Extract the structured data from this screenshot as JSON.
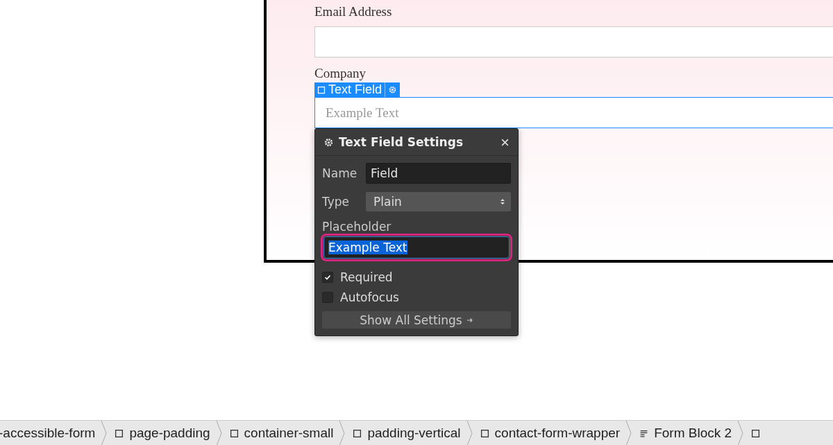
{
  "canvas": {
    "fields": [
      {
        "label": "Email Address",
        "selected": false
      },
      {
        "label": "Company",
        "placeholder": "Example Text",
        "selected": true,
        "tag": "Text Field"
      }
    ]
  },
  "settings_popup": {
    "title": "Text Field Settings",
    "name_label": "Name",
    "name_value": "Field",
    "type_label": "Type",
    "type_value": "Plain",
    "placeholder_label": "Placeholder",
    "placeholder_value": "Example Text",
    "options": [
      {
        "label": "Required",
        "checked": true
      },
      {
        "label": "Autofocus",
        "checked": false
      }
    ],
    "button": "Show All Settings"
  },
  "breadcrumbs": [
    {
      "label": "-accessible-form",
      "kind": "plain"
    },
    {
      "label": "page-padding",
      "kind": "box"
    },
    {
      "label": "container-small",
      "kind": "box"
    },
    {
      "label": "padding-vertical",
      "kind": "box"
    },
    {
      "label": "contact-form-wrapper",
      "kind": "box"
    },
    {
      "label": "Form Block 2",
      "kind": "form"
    }
  ]
}
